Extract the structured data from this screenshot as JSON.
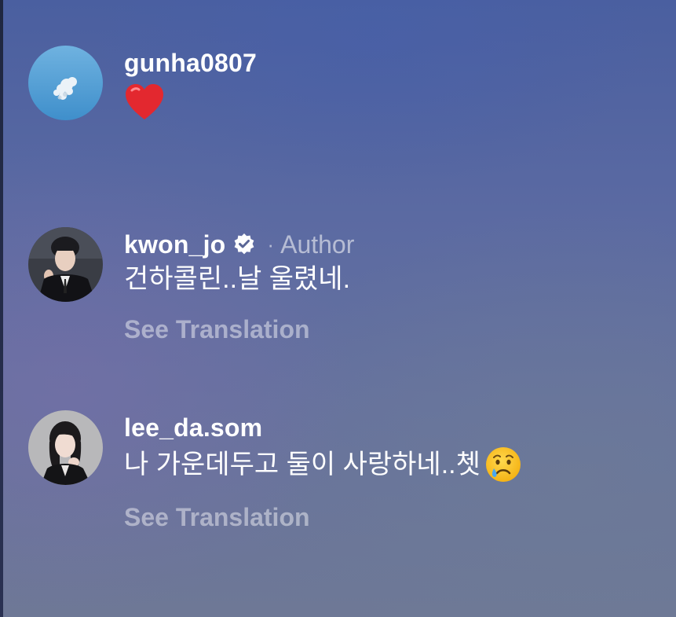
{
  "comments": [
    {
      "username": "gunha0807",
      "verified": false,
      "author_tag": "",
      "text": "",
      "emoji": "red-heart-icon",
      "see_translation": ""
    },
    {
      "username": "kwon_jo",
      "verified": true,
      "dot": "·",
      "author_tag": "Author",
      "text": "건하콜린..날 울렸네.",
      "see_translation": "See Translation"
    },
    {
      "username": "lee_da.som",
      "verified": false,
      "author_tag": "",
      "text": "나 가운데두고 둘이 사랑하네..쳇",
      "emoji": "crying-face-icon",
      "see_translation": "See Translation"
    }
  ],
  "colors": {
    "background_top": "#4a5fa0",
    "background_bottom": "#6e7896",
    "muted_text": "rgba(255,255,255,0.45)",
    "heart": "#e3282f"
  }
}
